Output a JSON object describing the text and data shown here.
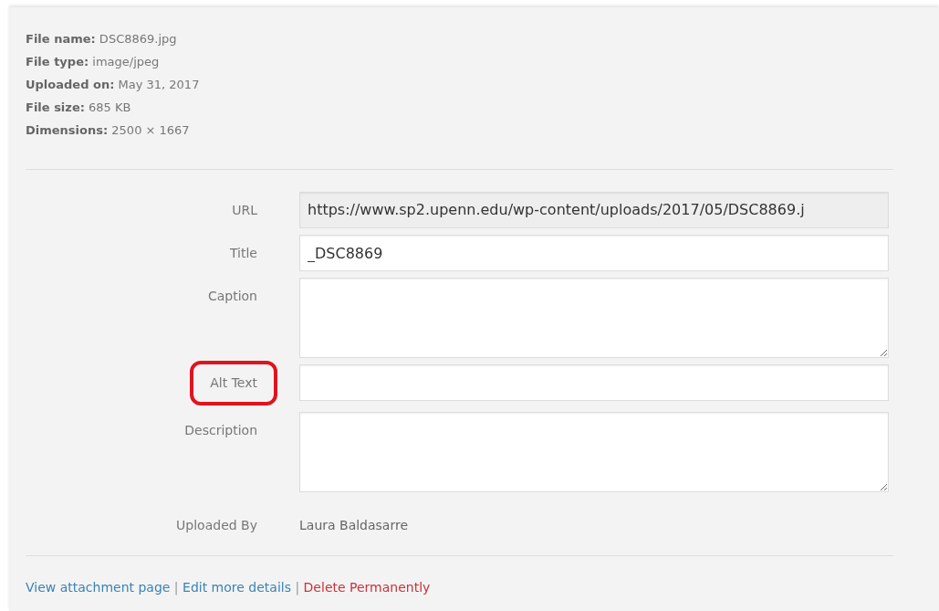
{
  "details": [
    {
      "label": "File name:",
      "value": "DSC8869.jpg"
    },
    {
      "label": "File type:",
      "value": "image/jpeg"
    },
    {
      "label": "Uploaded on:",
      "value": "May 31, 2017"
    },
    {
      "label": "File size:",
      "value": "685 KB"
    },
    {
      "label": "Dimensions:",
      "value": "2500 × 1667"
    }
  ],
  "fields": [
    {
      "kind": "readonly",
      "label": "URL",
      "value": "https://www.sp2.upenn.edu/wp-content/uploads/2017/05/DSC8869.j",
      "highlighted": false
    },
    {
      "kind": "text",
      "label": "Title",
      "value": "_DSC8869",
      "highlighted": false
    },
    {
      "kind": "textarea",
      "label": "Caption",
      "highlighted": false
    },
    {
      "kind": "text",
      "label": "Alt Text",
      "highlighted": true
    },
    {
      "kind": "textarea",
      "label": "Description",
      "highlighted": false
    },
    {
      "kind": "static",
      "label": "Uploaded By",
      "value": "Laura Baldasarre",
      "highlighted": false
    }
  ],
  "links": [
    {
      "label": "View attachment page",
      "kind": "normal"
    },
    {
      "label": "Edit more details",
      "kind": "normal"
    },
    {
      "label": "Delete Permanently",
      "kind": "danger"
    }
  ],
  "separator": "|"
}
